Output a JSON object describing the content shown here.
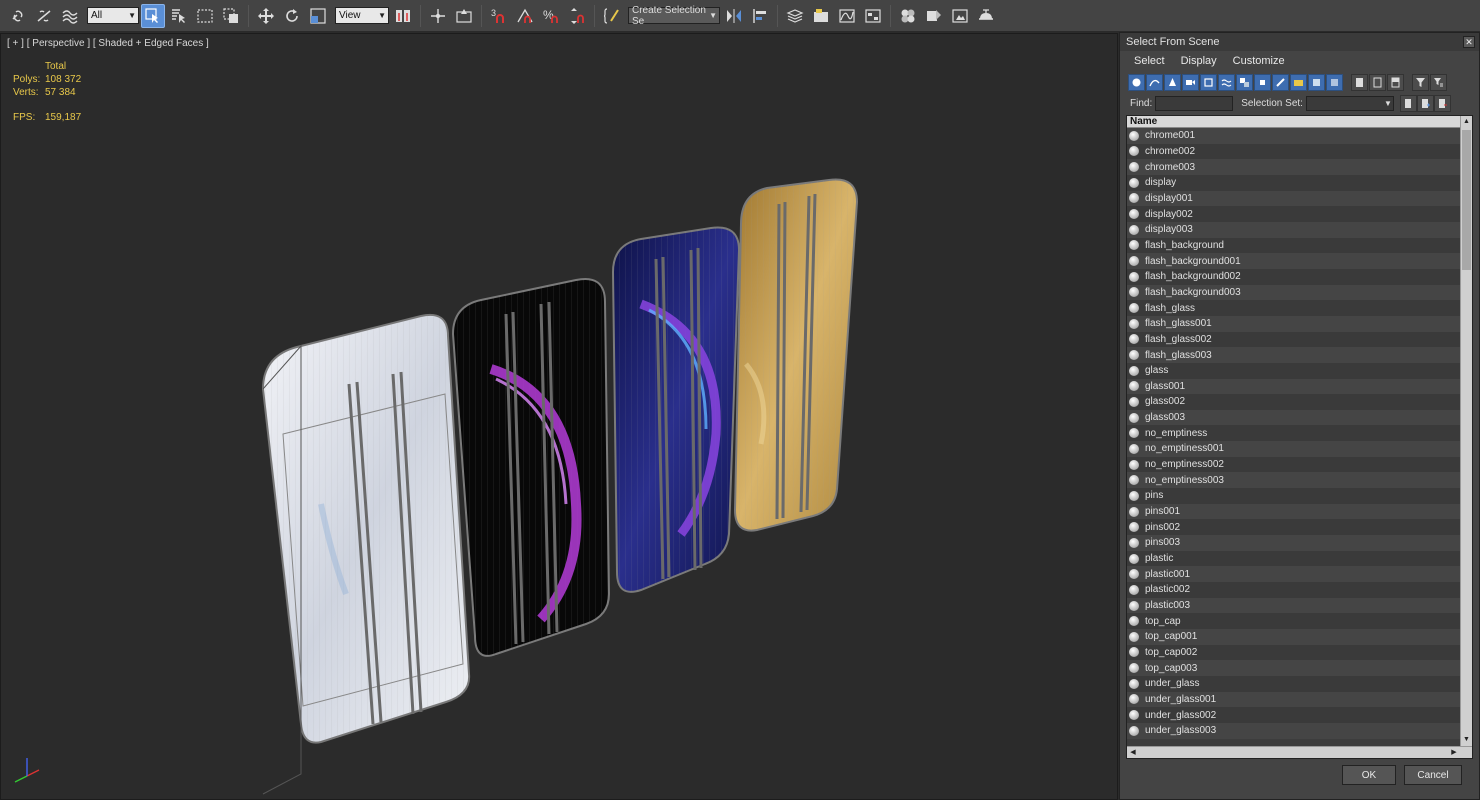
{
  "toolbar": {
    "selection_filter": "All",
    "reference_coord": "View",
    "named_selection": "Create Selection Se",
    "snap_number": "3",
    "percent_snap_label": "%"
  },
  "viewport": {
    "label": "[ + ] [ Perspective ] [ Shaded + Edged Faces ]",
    "stats": {
      "total_label": "Total",
      "polys_label": "Polys:",
      "polys_value": "108 372",
      "verts_label": "Verts:",
      "verts_value": "57 384",
      "fps_label": "FPS:",
      "fps_value": "159,187"
    }
  },
  "dialog": {
    "title": "Select From Scene",
    "menu": [
      "Select",
      "Display",
      "Customize"
    ],
    "find_label": "Find:",
    "selection_set_label": "Selection Set:",
    "column_name": "Name",
    "items": [
      "chrome001",
      "chrome002",
      "chrome003",
      "display",
      "display001",
      "display002",
      "display003",
      "flash_background",
      "flash_background001",
      "flash_background002",
      "flash_background003",
      "flash_glass",
      "flash_glass001",
      "flash_glass002",
      "flash_glass003",
      "glass",
      "glass001",
      "glass002",
      "glass003",
      "no_emptiness",
      "no_emptiness001",
      "no_emptiness002",
      "no_emptiness003",
      "pins",
      "pins001",
      "pins002",
      "pins003",
      "plastic",
      "plastic001",
      "plastic002",
      "plastic003",
      "top_cap",
      "top_cap001",
      "top_cap002",
      "top_cap003",
      "under_glass",
      "under_glass001",
      "under_glass002",
      "under_glass003"
    ],
    "ok_label": "OK",
    "cancel_label": "Cancel"
  },
  "colors": {
    "active_tool": "#5a8fd6",
    "stats_text": "#e8c84a",
    "phone_silver": "#d9dde6",
    "phone_black": "#0a0a0a",
    "phone_blue": "#1a1f6e",
    "phone_gold": "#c8a25a",
    "accent_purple": "#b43cd8"
  }
}
